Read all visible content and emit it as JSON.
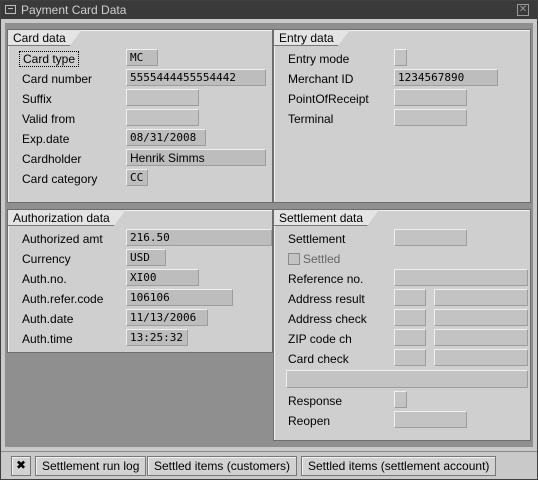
{
  "window": {
    "title": "Payment Card Data",
    "close": "✕"
  },
  "card_data": {
    "tab": "Card data",
    "fields": [
      {
        "label": "Card type",
        "value": "MC"
      },
      {
        "label": "Card number",
        "value": "5555444455554442"
      },
      {
        "label": "Suffix",
        "value": ""
      },
      {
        "label": "Valid from",
        "value": ""
      },
      {
        "label": "Exp.date",
        "value": "08/31/2008"
      },
      {
        "label": "Cardholder",
        "value": "Henrik Simms"
      },
      {
        "label": "Card category",
        "value": "CC"
      }
    ]
  },
  "entry_data": {
    "tab": "Entry data",
    "fields": [
      {
        "label": "Entry mode",
        "value": ""
      },
      {
        "label": "Merchant ID",
        "value": "1234567890"
      },
      {
        "label": "PointOfReceipt",
        "value": ""
      },
      {
        "label": "Terminal",
        "value": ""
      }
    ]
  },
  "authorization_data": {
    "tab": "Authorization data",
    "fields": [
      {
        "label": "Authorized amt",
        "value": "216.50"
      },
      {
        "label": "Currency",
        "value": "USD"
      },
      {
        "label": "Auth.no.",
        "value": "XI00"
      },
      {
        "label": "Auth.refer.code",
        "value": "106106"
      },
      {
        "label": "Auth.date",
        "value": "11/13/2006"
      },
      {
        "label": "Auth.time",
        "value": "13:25:32"
      }
    ]
  },
  "settlement_data": {
    "tab": "Settlement data",
    "settlement_label": "Settlement",
    "settled_label": "Settled",
    "reference_label": "Reference no.",
    "address_result_label": "Address result",
    "address_check_label": "Address check",
    "zip_label": "ZIP code ch",
    "card_check_label": "Card check",
    "response_label": "Response",
    "reopen_label": "Reopen"
  },
  "buttons": {
    "cancel_icon": "✖",
    "settlement_run_log": "Settlement run log",
    "settled_customers": "Settled items (customers)",
    "settled_account": "Settled items (settlement account)"
  }
}
